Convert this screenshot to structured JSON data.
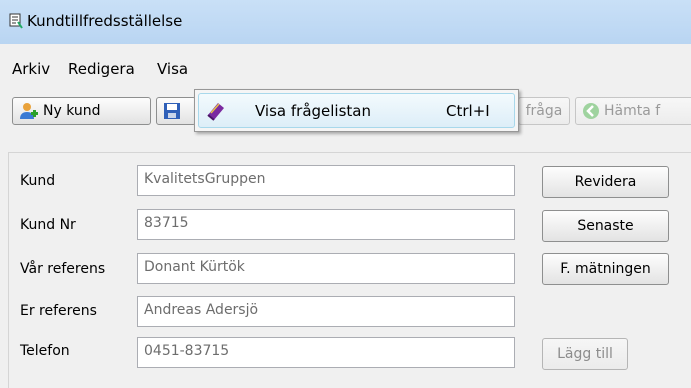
{
  "window": {
    "title": "Kundtillfredsställelse"
  },
  "menu": {
    "items": [
      "Arkiv",
      "Redigera",
      "Visa"
    ]
  },
  "toolbar": {
    "new_customer": "Ny kund",
    "question_partial": "fråga",
    "fetch_partial": "Hämta f"
  },
  "dropdown": {
    "label": "Visa frågelistan",
    "shortcut": "Ctrl+I"
  },
  "form": {
    "customer_label": "Kund",
    "customer_value": "KvalitetsGruppen",
    "customer_nr_label": "Kund Nr",
    "customer_nr_value": "83715",
    "our_ref_label": "Vår referens",
    "our_ref_value": "Donant Kürtök",
    "your_ref_label": "Er referens",
    "your_ref_value": "Andreas Adersjö",
    "phone_label": "Telefon",
    "phone_value": "0451-83715"
  },
  "actions": {
    "revise": "Revidera",
    "latest": "Senaste",
    "f_measurement": "F. mätningen",
    "add": "Lägg till"
  },
  "colors": {
    "titlebar": "#b9d5f2",
    "menu_highlight": "#ddeef8",
    "field_border": "#abadb3"
  }
}
